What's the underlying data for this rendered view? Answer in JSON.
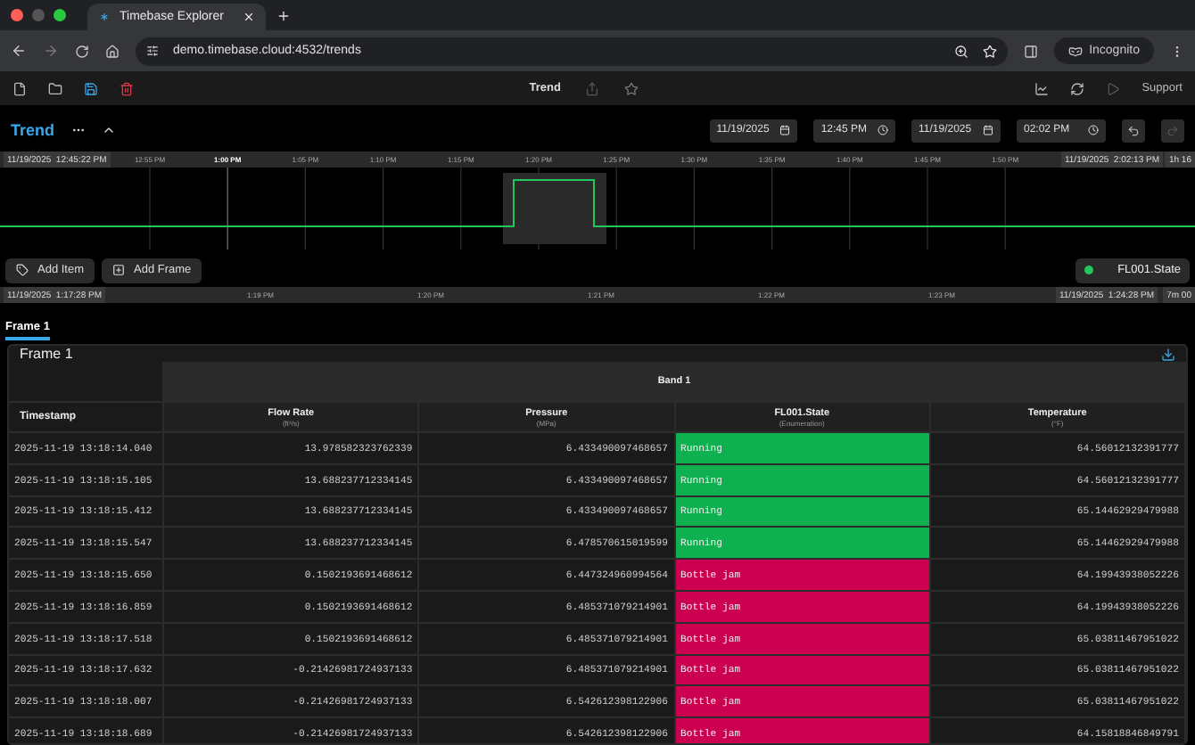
{
  "browser": {
    "tabs": [
      {
        "title": "Timebase Explorer",
        "selected": true
      }
    ],
    "url": "demo.timebase.cloud:4532/trends",
    "profile": "Incognito"
  },
  "toolbar": {
    "title": "Trend",
    "support": "Support"
  },
  "trend": {
    "title": "Trend",
    "expanded": true,
    "start_date": "11/19/2025",
    "start_time": "12:45 PM",
    "end_date": "11/19/2025",
    "end_time": "02:02 PM"
  },
  "overview": {
    "start": "11/19/2025  12:45:22 PM",
    "end": "11/19/2025  2:02:13 PM",
    "duration": "1h 16",
    "ticks": [
      {
        "label": "12:55 PM",
        "major": false
      },
      {
        "label": "1:00 PM",
        "major": true
      },
      {
        "label": "1:05 PM",
        "major": false
      },
      {
        "label": "1:10 PM",
        "major": false
      },
      {
        "label": "1:15 PM",
        "major": false
      },
      {
        "label": "1:20 PM",
        "major": false
      },
      {
        "label": "1:25 PM",
        "major": false
      },
      {
        "label": "1:30 PM",
        "major": false
      },
      {
        "label": "1:35 PM",
        "major": false
      },
      {
        "label": "1:40 PM",
        "major": false
      },
      {
        "label": "1:45 PM",
        "major": false
      },
      {
        "label": "1:50 PM",
        "major": false
      }
    ]
  },
  "actions": [
    {
      "label": "Add Item",
      "kind": "item"
    },
    {
      "label": "Add Frame",
      "kind": "frame"
    }
  ],
  "legend": [
    {
      "label": "FL001.State",
      "color": "#22c55e"
    }
  ],
  "detail": {
    "start": "11/19/2025  1:17:28 PM",
    "end": "11/19/2025  1:24:28 PM",
    "duration": "7m 00",
    "ticks": [
      "1:19 PM",
      "1:20 PM",
      "1:21 PM",
      "1:22 PM",
      "1:23 PM"
    ]
  },
  "frame_tabs": [
    {
      "label": "Frame 1",
      "selected": true
    }
  ],
  "frame": {
    "title": "Frame 1",
    "band": "Band 1",
    "columns": [
      {
        "name": "Timestamp"
      },
      {
        "name": "Flow Rate",
        "unit": "(ft³/s)"
      },
      {
        "name": "Pressure",
        "unit": "(MPa)"
      },
      {
        "name": "FL001.State",
        "unit": "(Enumeration)"
      },
      {
        "name": "Temperature",
        "unit": "(°F)"
      }
    ],
    "rows": [
      {
        "timestamp": "2025-11-19 13:18:14.040",
        "flow_rate": "13.978582323762339",
        "pressure": "6.433490097468657",
        "state": "Running",
        "color": "#0fb04f",
        "temperature": "64.56012132391777"
      },
      {
        "timestamp": "2025-11-19 13:18:15.105",
        "flow_rate": "13.688237712334145",
        "pressure": "6.433490097468657",
        "state": "Running",
        "color": "#0fb04f",
        "temperature": "64.56012132391777"
      },
      {
        "timestamp": "2025-11-19 13:18:15.412",
        "flow_rate": "13.688237712334145",
        "pressure": "6.433490097468657",
        "state": "Running",
        "color": "#0fb04f",
        "temperature": "65.14462929479988"
      },
      {
        "timestamp": "2025-11-19 13:18:15.547",
        "flow_rate": "13.688237712334145",
        "pressure": "6.478570615019599",
        "state": "Running",
        "color": "#0fb04f",
        "temperature": "65.14462929479988"
      },
      {
        "timestamp": "2025-11-19 13:18:15.650",
        "flow_rate": "0.1502193691468612",
        "pressure": "6.447324960994564",
        "state": "Bottle jam",
        "color": "#cc0050",
        "temperature": "64.19943938052226"
      },
      {
        "timestamp": "2025-11-19 13:18:16.859",
        "flow_rate": "0.1502193691468612",
        "pressure": "6.485371079214901",
        "state": "Bottle jam",
        "color": "#cc0050",
        "temperature": "64.19943938052226"
      },
      {
        "timestamp": "2025-11-19 13:18:17.518",
        "flow_rate": "0.1502193691468612",
        "pressure": "6.485371079214901",
        "state": "Bottle jam",
        "color": "#cc0050",
        "temperature": "65.03811467951022"
      },
      {
        "timestamp": "2025-11-19 13:18:17.632",
        "flow_rate": "-0.21426981724937133",
        "pressure": "6.485371079214901",
        "state": "Bottle jam",
        "color": "#cc0050",
        "temperature": "65.03811467951022"
      },
      {
        "timestamp": "2025-11-19 13:18:18.007",
        "flow_rate": "-0.21426981724937133",
        "pressure": "6.542612398122906",
        "state": "Bottle jam",
        "color": "#cc0050",
        "temperature": "65.03811467951022"
      },
      {
        "timestamp": "2025-11-19 13:18:18.689",
        "flow_rate": "-0.21426981724937133",
        "pressure": "6.542612398122906",
        "state": "Bottle jam",
        "color": "#cc0050",
        "temperature": "64.15818846849791"
      }
    ]
  }
}
